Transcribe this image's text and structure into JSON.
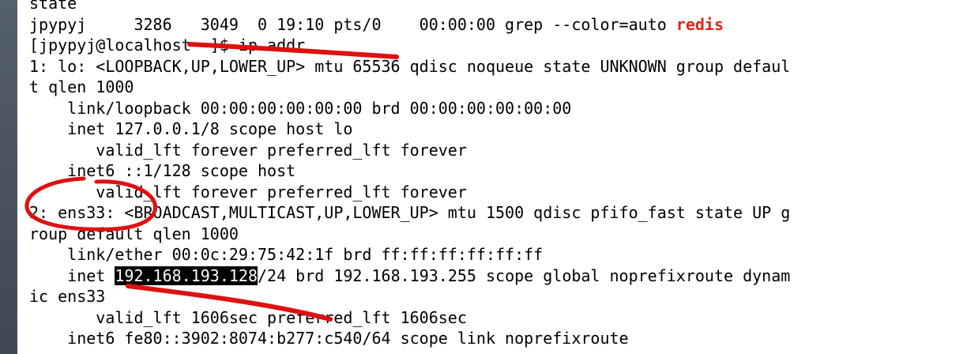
{
  "terminal": {
    "partial_top_line": "state",
    "grep_line": {
      "prefix": "jpypyj     3286   3049  0 19:10 pts/0    00:00:00 grep --color=auto ",
      "match": "redis"
    },
    "prompt": {
      "text": "[jpypyj@localhost ~]$ ",
      "command": "ip addr"
    },
    "output": [
      "1: lo: <LOOPBACK,UP,LOWER_UP> mtu 65536 qdisc noqueue state UNKNOWN group defaul",
      "t qlen 1000",
      "    link/loopback 00:00:00:00:00:00 brd 00:00:00:00:00:00",
      "    inet 127.0.0.1/8 scope host lo",
      "       valid_lft forever preferred_lft forever",
      "    inet6 ::1/128 scope host",
      "       valid_lft forever preferred_lft forever",
      "2: ens33: <BROADCAST,MULTICAST,UP,LOWER_UP> mtu 1500 qdisc pfifo_fast state UP g",
      "roup default qlen 1000",
      "    link/ether 00:0c:29:75:42:1f brd ff:ff:ff:ff:ff:ff"
    ],
    "inet_line": {
      "prefix": "    inet ",
      "selected": "192.168.193.128",
      "suffix": "/24 brd 192.168.193.255 scope global noprefixroute dynam"
    },
    "output_tail": [
      "ic ens33",
      "       valid_lft 1606sec preferred_lft 1606sec",
      "    inet6 fe80::3902:8074:b277:c540/64 scope link noprefixroute"
    ]
  },
  "colors": {
    "background": "#ffffff",
    "text": "#000000",
    "grep_match": "#e0241b",
    "selection": "#000000",
    "annotation": "#dd1111"
  }
}
